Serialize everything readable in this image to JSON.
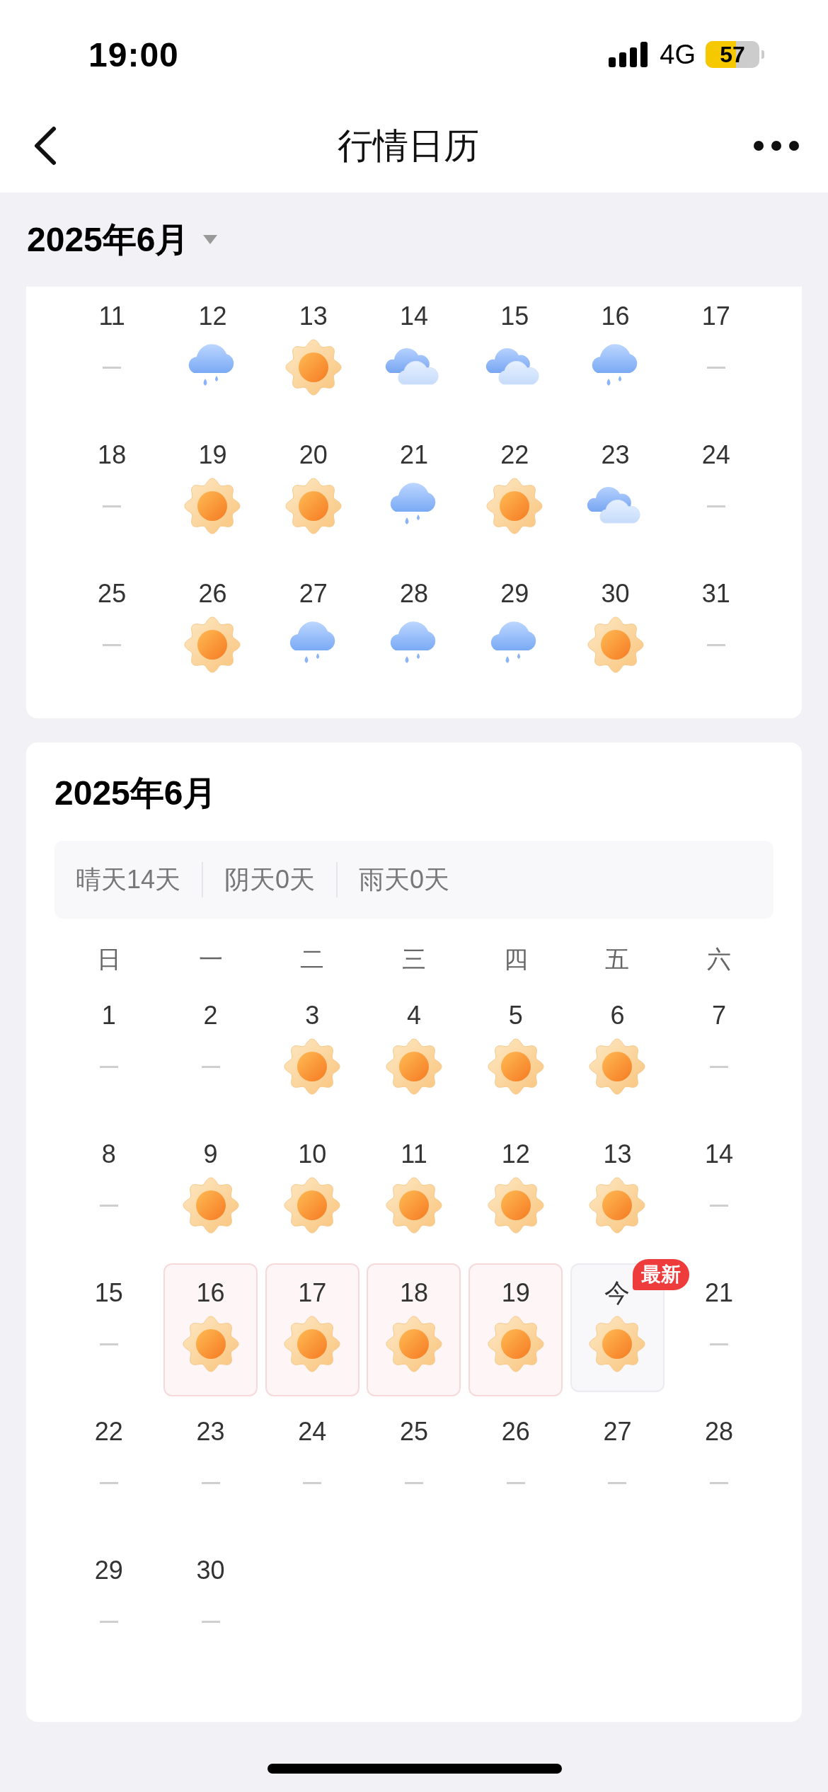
{
  "status_bar": {
    "time": "19:00",
    "network": "4G",
    "battery": "57"
  },
  "header": {
    "title": "行情日历"
  },
  "month_selector": {
    "label": "2025年6月"
  },
  "top_calendar": {
    "weeks": [
      [
        {
          "day": "11",
          "kind": "none"
        },
        {
          "day": "12",
          "kind": "rain"
        },
        {
          "day": "13",
          "kind": "sun"
        },
        {
          "day": "14",
          "kind": "cloud"
        },
        {
          "day": "15",
          "kind": "cloud"
        },
        {
          "day": "16",
          "kind": "rain"
        },
        {
          "day": "17",
          "kind": "none"
        }
      ],
      [
        {
          "day": "18",
          "kind": "none"
        },
        {
          "day": "19",
          "kind": "sun"
        },
        {
          "day": "20",
          "kind": "sun"
        },
        {
          "day": "21",
          "kind": "rain"
        },
        {
          "day": "22",
          "kind": "sun"
        },
        {
          "day": "23",
          "kind": "cloud"
        },
        {
          "day": "24",
          "kind": "none"
        }
      ],
      [
        {
          "day": "25",
          "kind": "none"
        },
        {
          "day": "26",
          "kind": "sun"
        },
        {
          "day": "27",
          "kind": "rain"
        },
        {
          "day": "28",
          "kind": "rain"
        },
        {
          "day": "29",
          "kind": "rain"
        },
        {
          "day": "30",
          "kind": "sun"
        },
        {
          "day": "31",
          "kind": "none"
        }
      ]
    ]
  },
  "calendar": {
    "title": "2025年6月",
    "summary": [
      "晴天14天",
      "阴天0天",
      "雨天0天"
    ],
    "weekdays": [
      "日",
      "一",
      "二",
      "三",
      "四",
      "五",
      "六"
    ],
    "weeks": [
      [
        {
          "day": "1",
          "kind": "none",
          "selected": false,
          "today": false
        },
        {
          "day": "2",
          "kind": "none",
          "selected": false,
          "today": false
        },
        {
          "day": "3",
          "kind": "sun",
          "selected": false,
          "today": false
        },
        {
          "day": "4",
          "kind": "sun",
          "selected": false,
          "today": false
        },
        {
          "day": "5",
          "kind": "sun",
          "selected": false,
          "today": false
        },
        {
          "day": "6",
          "kind": "sun",
          "selected": false,
          "today": false
        },
        {
          "day": "7",
          "kind": "none",
          "selected": false,
          "today": false
        }
      ],
      [
        {
          "day": "8",
          "kind": "none",
          "selected": false,
          "today": false
        },
        {
          "day": "9",
          "kind": "sun",
          "selected": false,
          "today": false
        },
        {
          "day": "10",
          "kind": "sun",
          "selected": false,
          "today": false
        },
        {
          "day": "11",
          "kind": "sun",
          "selected": false,
          "today": false
        },
        {
          "day": "12",
          "kind": "sun",
          "selected": false,
          "today": false
        },
        {
          "day": "13",
          "kind": "sun",
          "selected": false,
          "today": false
        },
        {
          "day": "14",
          "kind": "none",
          "selected": false,
          "today": false
        }
      ],
      [
        {
          "day": "15",
          "kind": "none",
          "selected": false,
          "today": false
        },
        {
          "day": "16",
          "kind": "sun",
          "selected": true,
          "today": false
        },
        {
          "day": "17",
          "kind": "sun",
          "selected": true,
          "today": false
        },
        {
          "day": "18",
          "kind": "sun",
          "selected": true,
          "today": false
        },
        {
          "day": "19",
          "kind": "sun",
          "selected": true,
          "today": false
        },
        {
          "day": "今",
          "kind": "sun",
          "selected": false,
          "today": true,
          "badge": "最新"
        },
        {
          "day": "21",
          "kind": "none",
          "selected": false,
          "today": false
        }
      ],
      [
        {
          "day": "22",
          "kind": "none",
          "selected": false,
          "today": false
        },
        {
          "day": "23",
          "kind": "none",
          "selected": false,
          "today": false
        },
        {
          "day": "24",
          "kind": "none",
          "selected": false,
          "today": false
        },
        {
          "day": "25",
          "kind": "none",
          "selected": false,
          "today": false
        },
        {
          "day": "26",
          "kind": "none",
          "selected": false,
          "today": false
        },
        {
          "day": "27",
          "kind": "none",
          "selected": false,
          "today": false
        },
        {
          "day": "28",
          "kind": "none",
          "selected": false,
          "today": false
        }
      ],
      [
        {
          "day": "29",
          "kind": "none",
          "selected": false,
          "today": false
        },
        {
          "day": "30",
          "kind": "none",
          "selected": false,
          "today": false
        }
      ]
    ]
  }
}
